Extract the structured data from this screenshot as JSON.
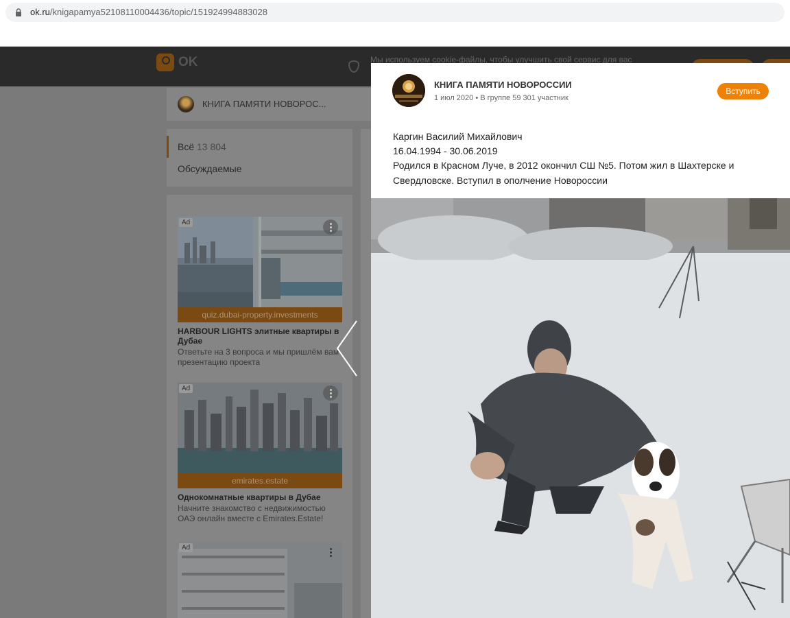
{
  "browser": {
    "url_host": "ok.ru",
    "url_path": "/knigapamya52108110004436/topic/151924994883028"
  },
  "header": {
    "logo_text": "OK",
    "cookie_notice": "Мы используем cookie-файлы, чтобы улучшить свой сервис для вас"
  },
  "group_bar": {
    "name": "КНИГА ПАМЯТИ НОВОРОС..."
  },
  "nav": {
    "all_label": "Всё",
    "all_count": "13 804",
    "discussed_label": "Обсуждаемые"
  },
  "ads": [
    {
      "label": "Ad",
      "source": "quiz.dubai-property.investments",
      "title": "HARBOUR LIGHTS элитные квартиры в Дубае",
      "text": "Ответьте на 3 вопроса и мы пришлём вам презентацию проекта"
    },
    {
      "label": "Ad",
      "source": "emirates.estate",
      "title": "Однокомнатные квартиры в Дубае",
      "text": "Начните знакомство с недвижимостью ОАЭ онлайн вместе с Emirates.Estate!"
    },
    {
      "label": "Ad"
    }
  ],
  "post": {
    "group_name": "КНИГА ПАМЯТИ НОВОРОССИИ",
    "meta": "1 июл 2020 • В группе 59 301 участник",
    "join_label": "Вступить",
    "lines": [
      "Каргин Василий Михайлович",
      "16.04.1994 - 30.06.2019",
      "Родился в Красном Луче, в 2012 окончил СШ №5. Потом жил в Шахтерске и",
      "Свердловске. Вступил в ополчение Новороссии"
    ]
  },
  "colors": {
    "accent": "#ee8208",
    "overlay_bg": "#7a7a7a"
  },
  "icons": [
    "lock-icon",
    "ok-logo-icon",
    "shield-icon",
    "more-icon",
    "chevron-left-icon"
  ]
}
